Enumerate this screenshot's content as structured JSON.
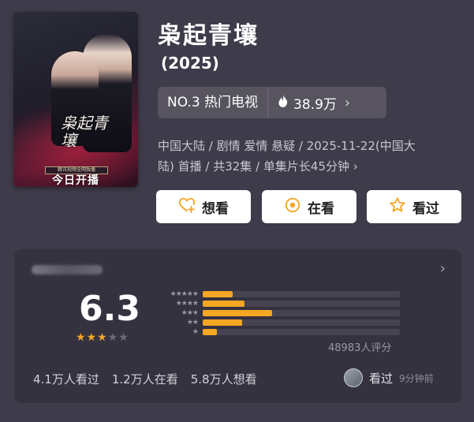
{
  "title": "枭起青壤",
  "year": "(2025)",
  "poster": {
    "calligraphy": "枭起青壤",
    "tag_text": "腾讯视频全网独播",
    "banner": "今日开播"
  },
  "rank": {
    "label": "NO.3 热门电视",
    "heat": "38.9万"
  },
  "meta": {
    "line1": "中国大陆 / 剧情 爱情 悬疑 / 2025-11-22(中国大",
    "line2": "陆) 首播 / 共32集 / 单集片长45分钟"
  },
  "buttons": {
    "want": "想看",
    "watching": "在看",
    "watched": "看过"
  },
  "rating": {
    "score": "6.3",
    "stars_filled": 3,
    "stars_total": 5,
    "count_text": "48983人评分",
    "distribution": [
      {
        "stars": "★★★★★",
        "fraction": 0.15
      },
      {
        "stars": "★★★★",
        "fraction": 0.21
      },
      {
        "stars": "★★★",
        "fraction": 0.35
      },
      {
        "stars": "★★",
        "fraction": 0.2
      },
      {
        "stars": "★",
        "fraction": 0.07
      }
    ]
  },
  "stats": {
    "watched": "4.1万人看过",
    "watching": "1.2万人在看",
    "want": "5.8万人想看"
  },
  "recent": {
    "action": "看过",
    "time": "9分钟前"
  },
  "colors": {
    "background": "#3e3b4a",
    "card": "#353240",
    "accent": "#f5a623"
  }
}
